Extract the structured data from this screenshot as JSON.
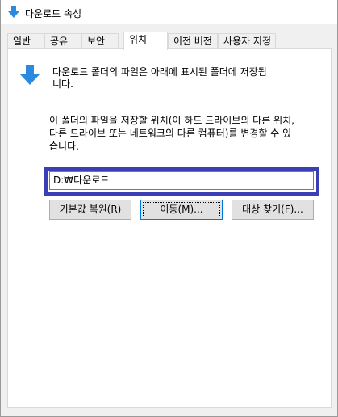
{
  "window": {
    "title": "다운로드 속성",
    "title_icon": "download-arrow-icon"
  },
  "tabs": [
    {
      "label": "일반",
      "active": false
    },
    {
      "label": "공유",
      "active": false
    },
    {
      "label": "보안",
      "active": false
    },
    {
      "label": "위치",
      "active": true
    },
    {
      "label": "이전 버전",
      "active": false
    },
    {
      "label": "사용자 지정",
      "active": false
    }
  ],
  "location": {
    "icon": "download-arrow-icon",
    "description_line1": "다운로드 폴더의 파일은 아래에 표시된 폴더에 저장됩",
    "description_line2": "니다.",
    "change_line1": "이 폴더의 파일을 저장할 위치(이 하드 드라이브의 다른 위치,",
    "change_line2": "다른 드라이브 또는 네트워크의 다른 컴퓨터)를 변경할 수 있",
    "change_line3": "습니다.",
    "path_value": "D:₩다운로드"
  },
  "buttons": {
    "restore_label": "기본값 복원(R)",
    "move_label": "이동(M)...",
    "find_label": "대상 찾기(F)..."
  },
  "colors": {
    "accent_blue": "#2b8ae0",
    "focus_frame": "#3b3fb5"
  }
}
